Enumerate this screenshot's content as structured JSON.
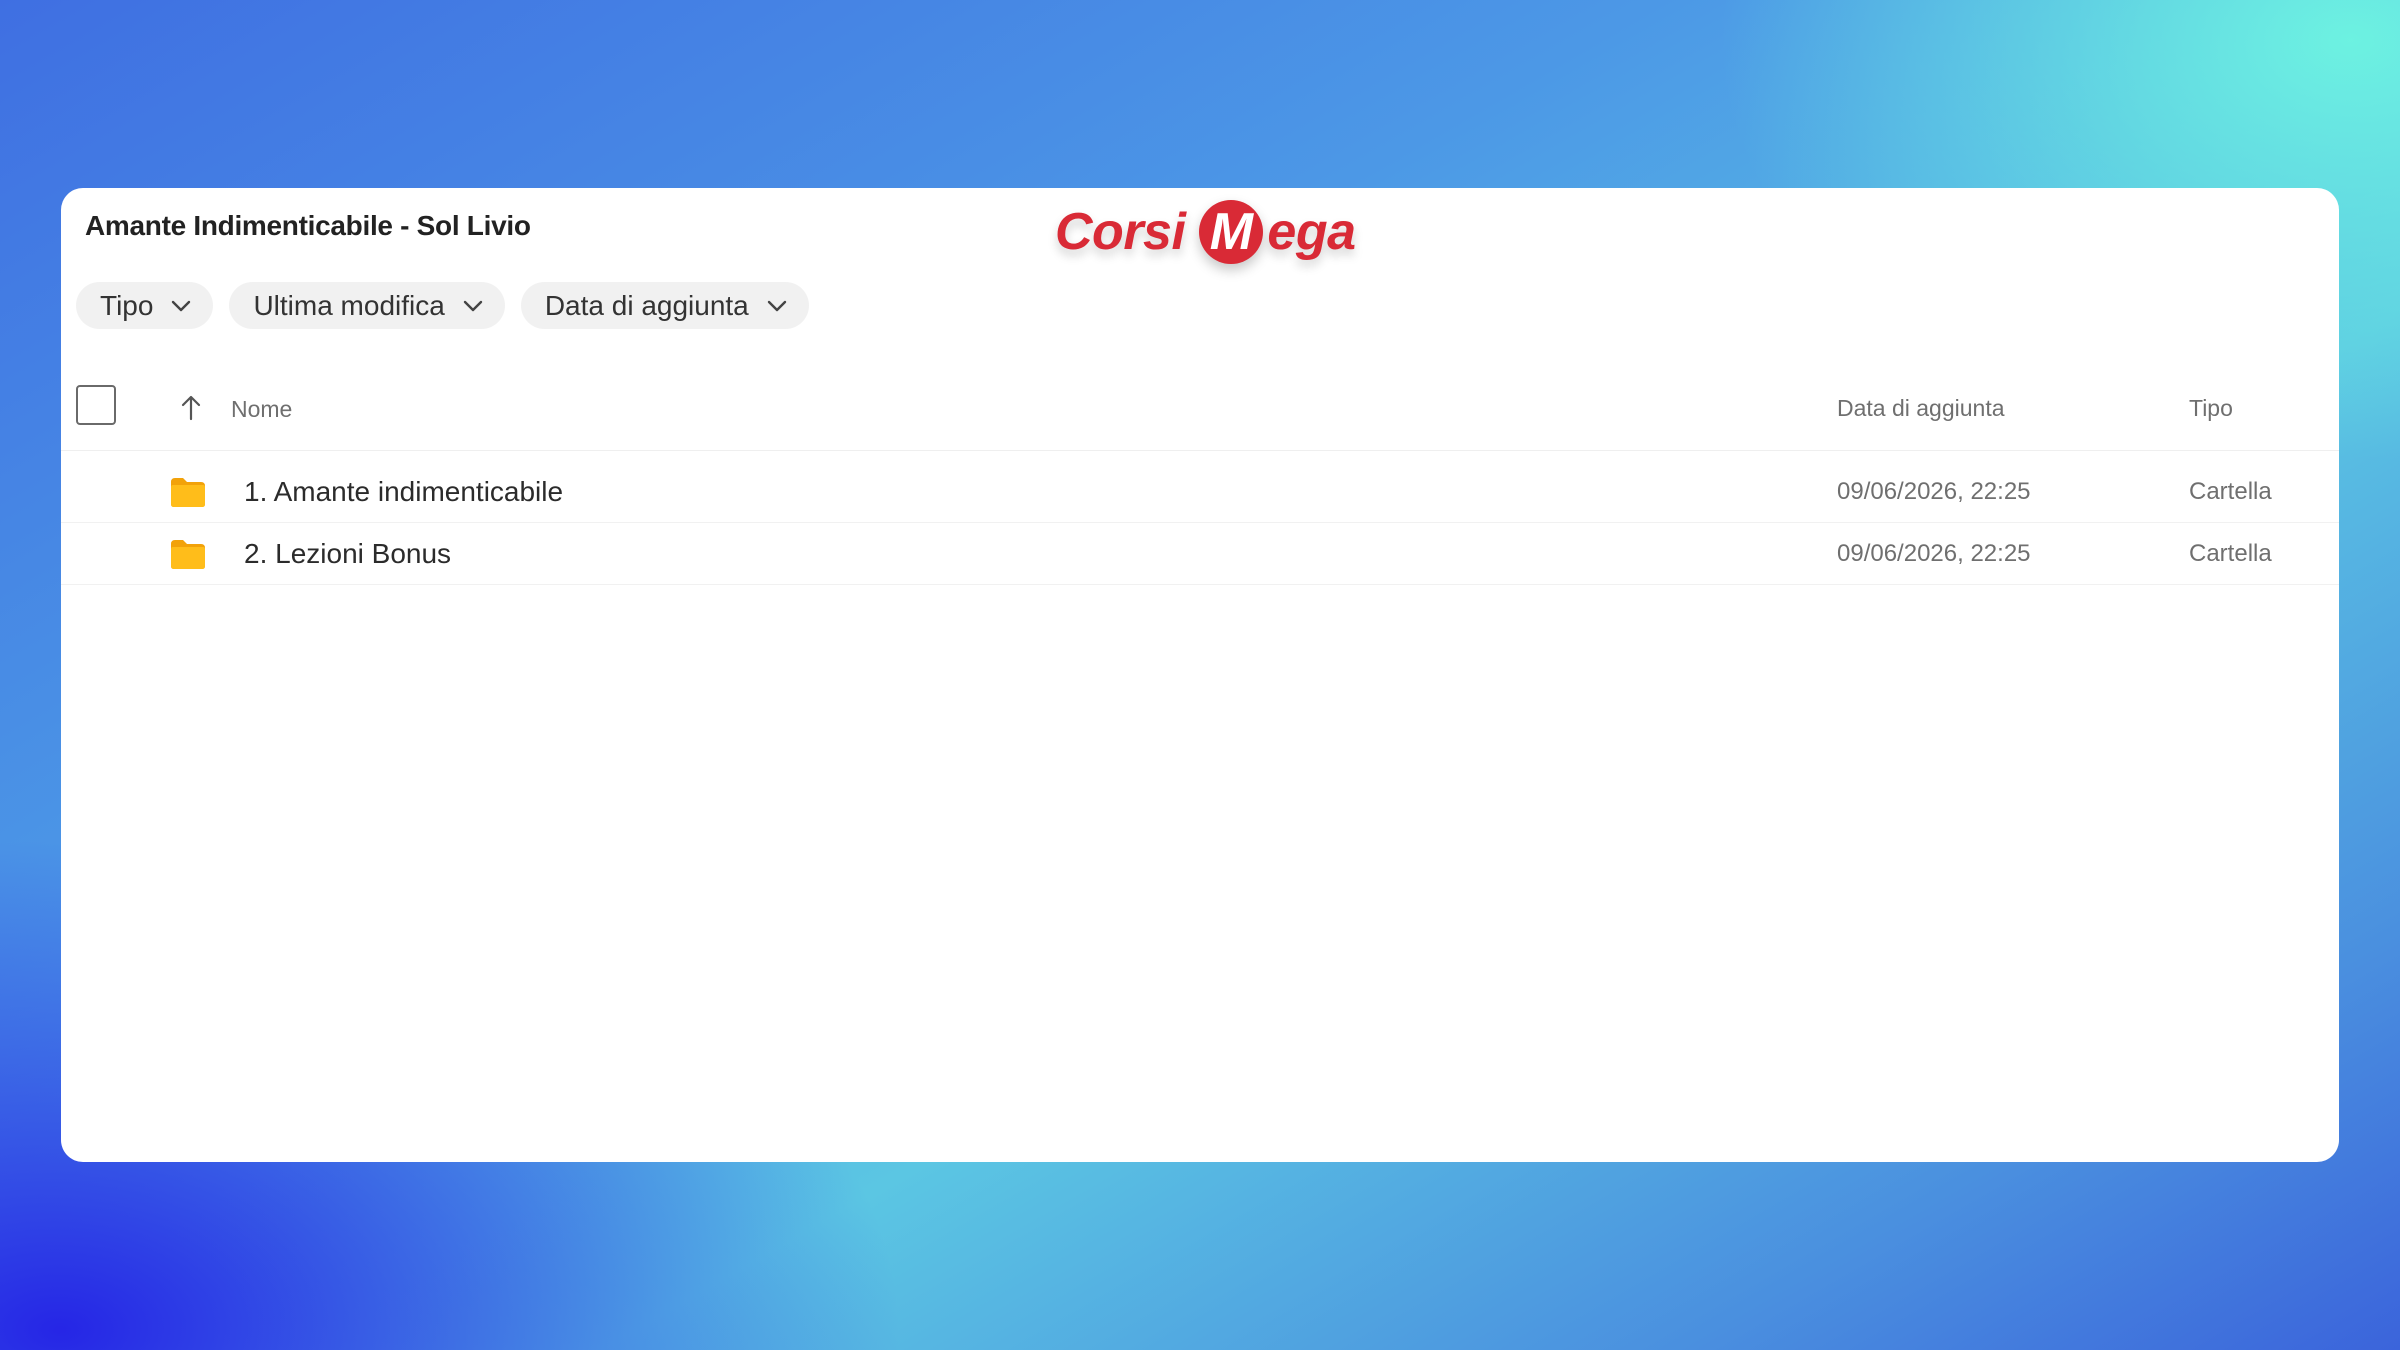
{
  "window": {
    "title": "Amante Indimenticabile - Sol Livio"
  },
  "logo": {
    "part1": "Corsi",
    "m": "M",
    "part2": "ega"
  },
  "filters": [
    {
      "label": "Tipo"
    },
    {
      "label": "Ultima modifica"
    },
    {
      "label": "Data di aggiunta"
    }
  ],
  "columns": {
    "name": "Nome",
    "added": "Data di aggiunta",
    "type": "Tipo"
  },
  "rows": [
    {
      "name": "1. Amante indimenticabile",
      "added": "09/06/2026, 22:25",
      "type": "Cartella",
      "icon": "folder-icon"
    },
    {
      "name": "2. Lezioni Bonus",
      "added": "09/06/2026, 22:25",
      "type": "Cartella",
      "icon": "folder-icon"
    }
  ],
  "colors": {
    "folder": "#FFB712",
    "logo_red": "#D92A36"
  }
}
